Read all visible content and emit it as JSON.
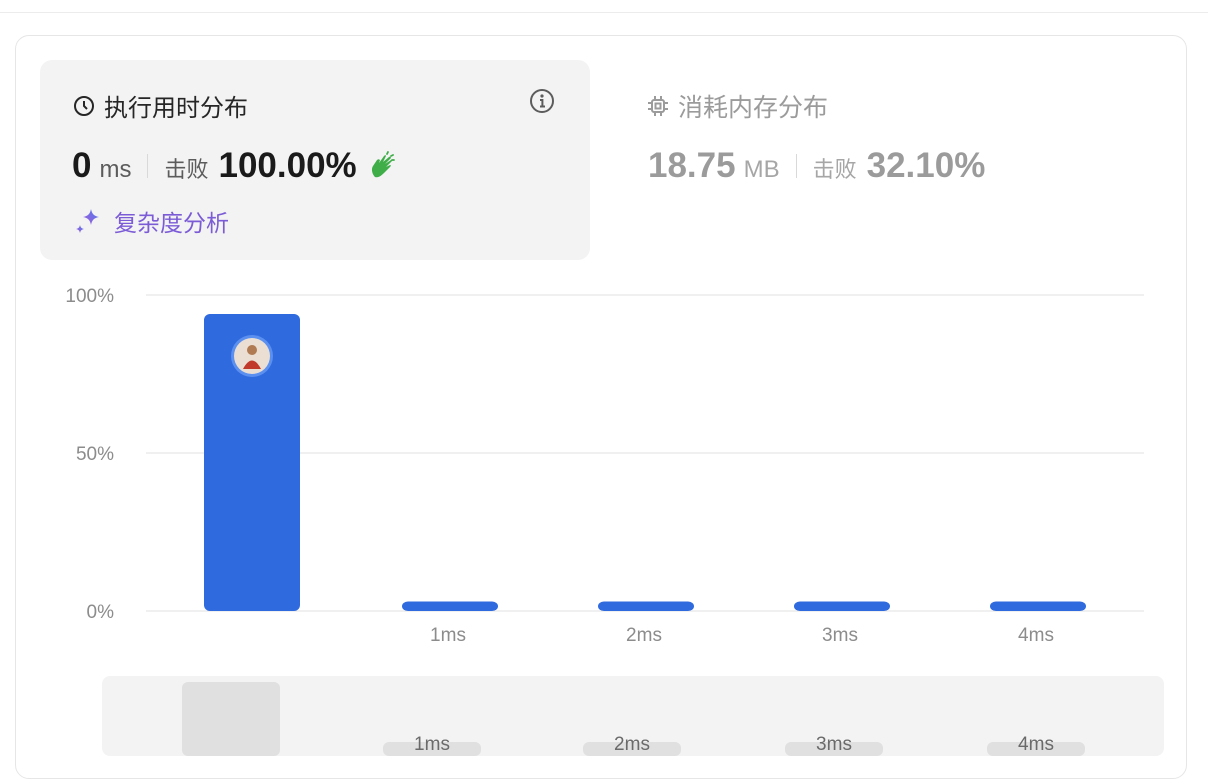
{
  "runtime": {
    "title": "执行用时分布",
    "value": "0",
    "unit": "ms",
    "beat_label": "击败",
    "beat_value": "100.00%",
    "complexity_label": "复杂度分析"
  },
  "memory": {
    "title": "消耗内存分布",
    "value": "18.75",
    "unit": "MB",
    "beat_label": "击败",
    "beat_value": "32.10%"
  },
  "chart_data": {
    "type": "bar",
    "categories": [
      "",
      "1ms",
      "2ms",
      "3ms",
      "4ms"
    ],
    "values": [
      94,
      3,
      3,
      3,
      3
    ],
    "ylim": [
      0,
      100
    ],
    "yticks": [
      "100%",
      "50%",
      "0%"
    ],
    "grid": true,
    "bar_color": "#2f6ade",
    "highlight_color": "#2f6ade"
  },
  "minimap": {
    "labels": [
      "1ms",
      "2ms",
      "3ms",
      "4ms"
    ]
  },
  "colors": {
    "accent_purple": "#7b5bd6",
    "clap_green": "#3fae49",
    "bar_blue": "#2f6ade"
  },
  "icons": {
    "runtime": "clock-icon",
    "info": "info-icon",
    "clap": "clap-icon",
    "complexity": "sparkle-icon",
    "memory": "chip-icon",
    "avatar": "user-avatar"
  }
}
